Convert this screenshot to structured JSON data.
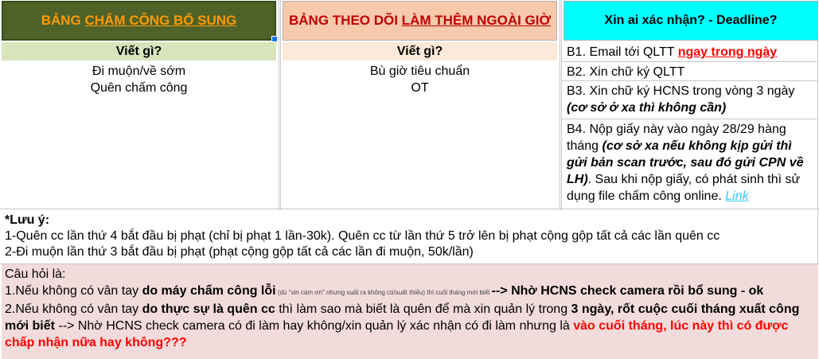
{
  "header": {
    "col1": {
      "prefix": "BẢNG ",
      "underlined": "CHẤM CÔNG BỔ SUNG"
    },
    "col2": {
      "prefix": "BẢNG THEO DÕI ",
      "underlined": "LÀM THÊM NGOÀI GIỜ"
    },
    "col3": "Xin ai xác nhận? - Deadline?"
  },
  "subheader": {
    "col1": "Viết gì?",
    "col2": "Viết gì?"
  },
  "col1_items": [
    "Đi muộn/về sớm",
    "Quên chấm công"
  ],
  "col2_items": [
    "Bù giờ tiêu chuẩn",
    "OT"
  ],
  "steps": {
    "b1": {
      "text": "B1. Email tới QLTT ",
      "highlight": "ngay trong ngày"
    },
    "b2": "B2. Xin chữ ký QLTT",
    "b3": {
      "text": "B3. Xin chữ ký HCNS trong vòng 3 ngày",
      "note": "(cơ sở ở xa thì không cần)"
    },
    "b4": {
      "text1": "B4. Nộp giấy này vào ngày 28/29 hàng tháng ",
      "note": "(cơ sở xa nếu không kịp gửi thì gửi bản scan trước, sau đó gửi CPN về LH)",
      "text2": ". Sau khi nộp giấy, có phát sinh thì sử dụng file chấm công online. ",
      "link": "Link"
    }
  },
  "note": {
    "title": "*Lưu ý:",
    "line1": "1-Quên cc lần thứ 4 bắt đầu bị phạt (chỉ bị phạt 1 lần-30k). Quên cc từ lần thứ 5 trở lên bị phạt cộng gộp tất cả các lần quên cc",
    "line2": "2-Đi muộn lần thứ 3 bắt đầu bị phạt (phạt cộng gộp tất cả các lần đi muộn, 50k/lần)"
  },
  "question": {
    "title": "Câu hỏi là:",
    "q1_a": "1.Nếu không có vân tay ",
    "q1_b": "do máy chấm công lỗi",
    "q1_small": " (dù \"xin cám ơn\" nhưng xuất ra không có/xuất thiếu) thì cuối tháng mới biết ",
    "q1_c": "--> ",
    "q1_d": "Nhờ HCNS check camera rồi bổ sung - ok",
    "q2_a": "2.Nếu không có vân tay ",
    "q2_b": "do thực sự là quên cc",
    "q2_c": " thì làm sao mà biết là quên để mà xin quản lý trong ",
    "q2_d": "3 ngày, rốt cuộc cuối tháng xuất công mới biết",
    "q2_e": " --> Nhờ HCNS check camera có đi làm hay không/xin quản lý xác nhận có đi làm nhưng là ",
    "q2_f": "vào cuối tháng, lúc này thì có được chấp nhận nữa hay không???"
  }
}
